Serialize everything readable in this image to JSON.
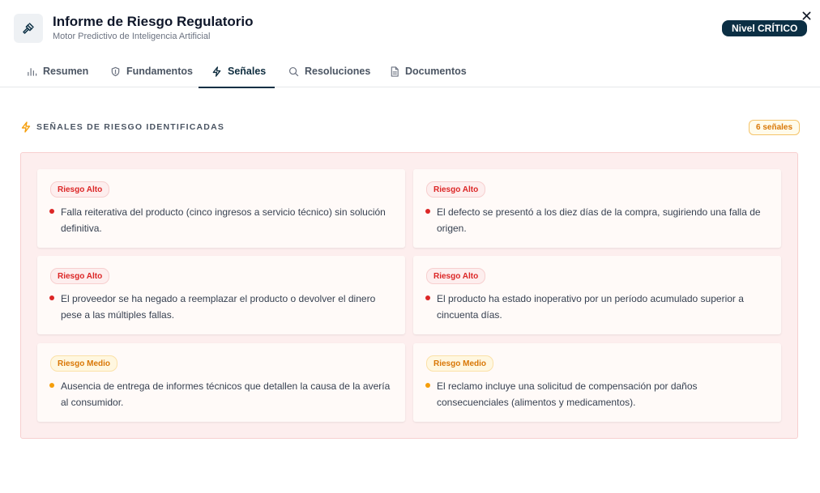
{
  "header": {
    "title": "Informe de Riesgo Regulatorio",
    "subtitle": "Motor Predictivo de Inteligencia Artificial",
    "level_badge": "Nivel CRÍTICO",
    "app_icon": "gavel-icon",
    "close_icon": "close-icon"
  },
  "tabs": [
    {
      "label": "Resumen",
      "icon": "bar-chart-icon",
      "active": false
    },
    {
      "label": "Fundamentos",
      "icon": "shield-icon",
      "active": false
    },
    {
      "label": "Señales",
      "icon": "lightning-icon",
      "active": true
    },
    {
      "label": "Resoluciones",
      "icon": "search-icon",
      "active": false
    },
    {
      "label": "Documentos",
      "icon": "document-icon",
      "active": false
    }
  ],
  "section": {
    "title": "SEÑALES DE RIESGO IDENTIFICADAS",
    "count_label": "6 señales",
    "icon": "lightning-icon"
  },
  "signals": [
    {
      "risk": "Riesgo Alto",
      "level": "high",
      "text": "Falla reiterativa del producto (cinco ingresos a servicio técnico) sin solución definitiva."
    },
    {
      "risk": "Riesgo Alto",
      "level": "high",
      "text": "El defecto se presentó a los diez días de la compra, sugiriendo una falla de origen."
    },
    {
      "risk": "Riesgo Alto",
      "level": "high",
      "text": "El proveedor se ha negado a reemplazar el producto o devolver el dinero pese a las múltiples fallas."
    },
    {
      "risk": "Riesgo Alto",
      "level": "high",
      "text": "El producto ha estado inoperativo por un período acumulado superior a cincuenta días."
    },
    {
      "risk": "Riesgo Medio",
      "level": "medium",
      "text": "Ausencia de entrega de informes técnicos que detallen la causa de la avería al consumidor."
    },
    {
      "risk": "Riesgo Medio",
      "level": "medium",
      "text": "El reclamo incluye una solicitud de compensación por daños consecuenciales (alimentos y medicamentos)."
    }
  ],
  "colors": {
    "primary": "#0b2f44",
    "high": "#dc2626",
    "medium": "#d97706",
    "panel_bg": "#fdeeee"
  }
}
